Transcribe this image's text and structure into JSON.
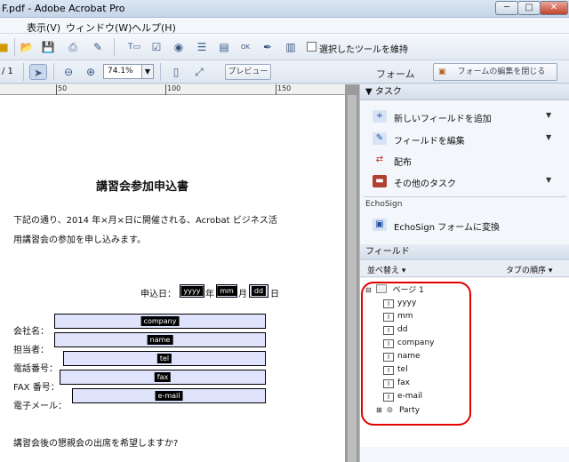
{
  "window": {
    "title": "F.pdf - Adobe Acrobat Pro",
    "minimize": "─",
    "maximize": "□",
    "close": "✕"
  },
  "menu": [
    "表示(V)",
    "ウィンドウ(W)",
    "ヘルプ(H)"
  ],
  "toolbar": {
    "keep_tool_label": "選択したツールを維持",
    "page_count": "/ 1",
    "zoom": "74.1%",
    "preview_label": "プレビュー",
    "form_label": "フォーム",
    "close_edit_label": "フォームの編集を閉じる"
  },
  "ruler": {
    "labels": [
      "50",
      "100",
      "150"
    ]
  },
  "document": {
    "title": "講習会参加申込書",
    "line1": "下記の通り、2014 年×月×日に開催される、Acrobat ビジネス活",
    "line2": "用講習会の参加を申し込みます。",
    "date_label": "申込日：",
    "date_fields": [
      "yyyy",
      "mm",
      "dd"
    ],
    "date_units": [
      "年",
      "月",
      "日"
    ],
    "fields": [
      {
        "label": "会社名：",
        "name": "company"
      },
      {
        "label": "担当者：",
        "name": "name"
      },
      {
        "label": "電話番号：",
        "name": "tel"
      },
      {
        "label": "FAX 番号：",
        "name": "fax"
      },
      {
        "label": "電子メール：",
        "name": "e-mail"
      }
    ],
    "question": "講習会後の懇親会の出席を希望しますか?"
  },
  "panel": {
    "tasks_header": "▼ タスク",
    "tasks": [
      {
        "label": "新しいフィールドを追加",
        "icon": "add-field-icon",
        "arrow": "▼"
      },
      {
        "label": "フィールドを編集",
        "icon": "edit-field-icon",
        "arrow": "▼"
      },
      {
        "label": "配布",
        "icon": "distribute-icon",
        "arrow": ""
      },
      {
        "label": "その他のタスク",
        "icon": "toolbox-icon",
        "arrow": "▼"
      }
    ],
    "echosign_label": "EchoSign",
    "echosign_task": "EchoSign フォームに変換",
    "fields_header": "フィールド",
    "sort_label": "並べ替え ▾",
    "tab_order_label": "タブの順序 ▾",
    "tree_root": "ページ 1",
    "tree_items": [
      "yyyy",
      "mm",
      "dd",
      "company",
      "name",
      "tel",
      "fax",
      "e-mail"
    ],
    "tree_group": "Party"
  },
  "colors": {
    "field_fill": "#dfe3fb",
    "highlight_ring": "#e00000",
    "tag_bg": "#000000"
  }
}
